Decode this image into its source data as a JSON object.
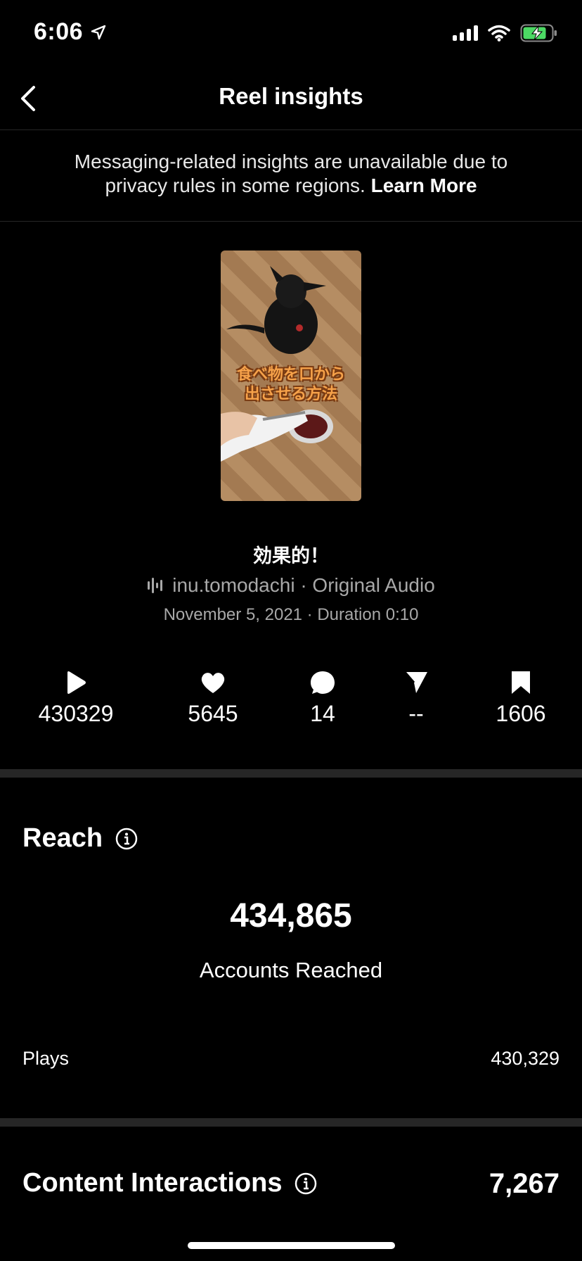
{
  "status_bar": {
    "time": "6:06"
  },
  "header": {
    "title": "Reel insights"
  },
  "notice": {
    "text": "Messaging-related insights are unavailable due to privacy rules in some regions.",
    "link": "Learn More"
  },
  "reel": {
    "thumbnail_text_line1": "食べ物を口から",
    "thumbnail_text_line2": "出させる方法",
    "caption": "効果的！",
    "audio": "inu.tomodachi · Original Audio",
    "meta": "November 5, 2021 · Duration 0:10"
  },
  "stats": {
    "plays": "430329",
    "likes": "5645",
    "comments": "14",
    "shares": "--",
    "saves": "1606"
  },
  "reach": {
    "title": "Reach",
    "accounts_reached": "434,865",
    "accounts_reached_label": "Accounts Reached",
    "plays_label": "Plays",
    "plays_value": "430,329"
  },
  "interactions": {
    "title": "Content Interactions",
    "value": "7,267"
  },
  "colors": {
    "background": "#000000",
    "secondary_text": "#a8a8a8",
    "divider": "#262626",
    "battery": "#4cd964"
  }
}
